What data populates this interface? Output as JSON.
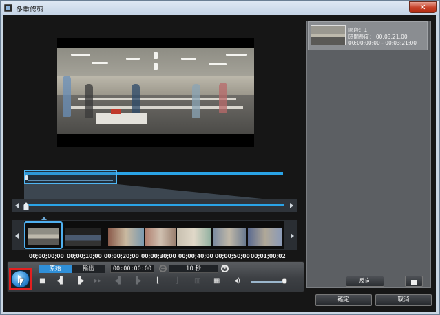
{
  "window": {
    "title": "多重修剪",
    "close_label": "✕"
  },
  "timeline": {
    "timecodes": [
      "00;00;00;00",
      "00;00;10;00",
      "00;00;20;00",
      "00;00;30;00",
      "00;00;40;00",
      "00;00;50;00",
      "00;01;00;02"
    ]
  },
  "controls": {
    "tab_source": "原始",
    "tab_output": "輸出",
    "timecode": "00:00:00:00",
    "zoom_value": "10 秒",
    "volume_level": 0.9
  },
  "clip_panel": {
    "clip_line1": "區段：1",
    "clip_line2": "時間長度： 00;03;21;00",
    "clip_line3": "00;00;00;00 - 00;03;21;00",
    "reverse_label": "反向"
  },
  "footer": {
    "ok_label": "確定",
    "cancel_label": "取消"
  }
}
